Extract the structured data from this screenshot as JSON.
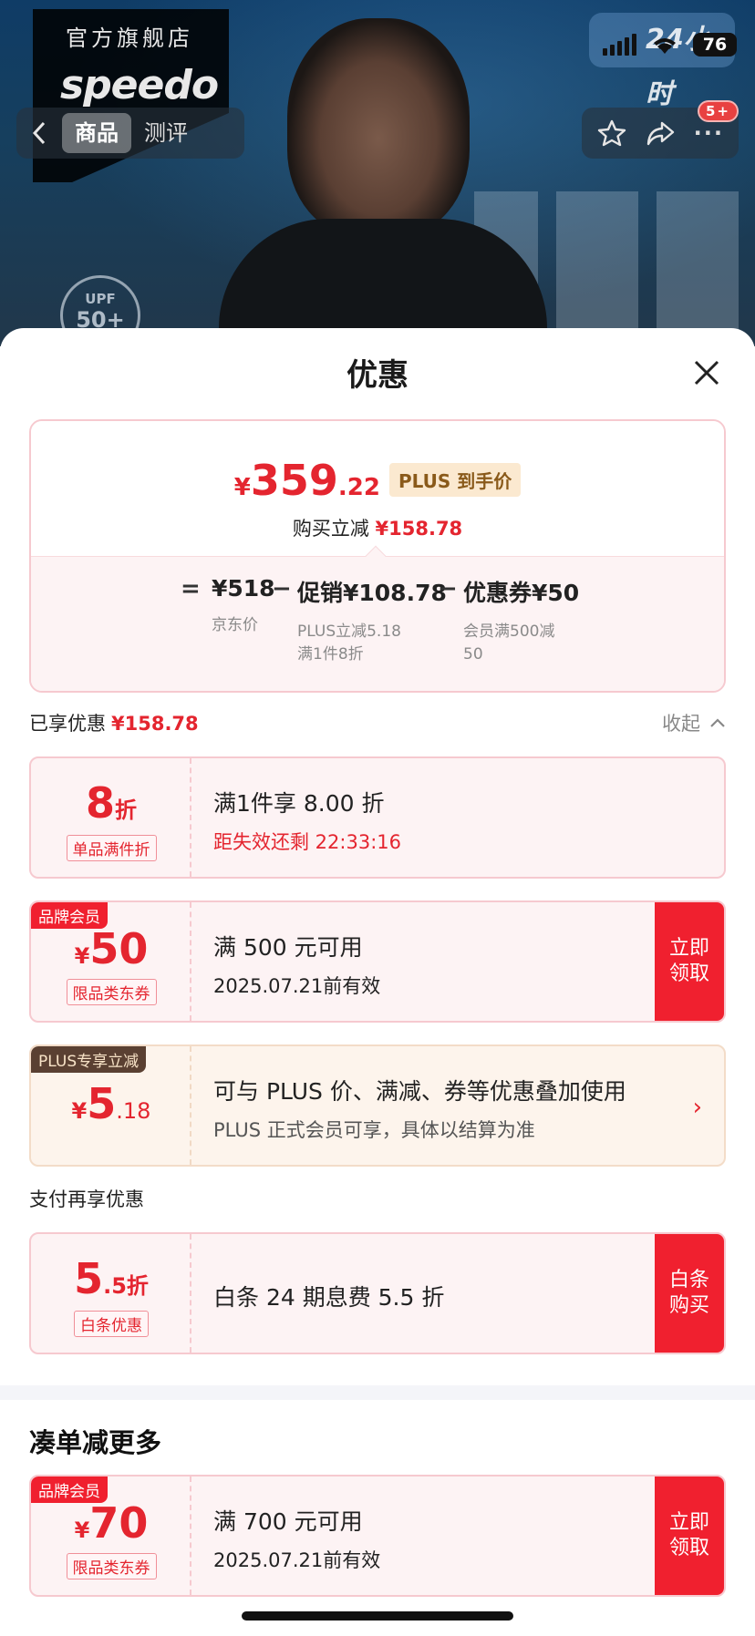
{
  "hero": {
    "store_label": "官方旗舰店",
    "brand": "speedo",
    "upf_label": "UPF",
    "upf_value": "50+",
    "badge": "24小时"
  },
  "status_bar": {
    "battery": "76"
  },
  "nav": {
    "tabs": [
      {
        "label": "商品",
        "active": true
      },
      {
        "label": "测评",
        "active": false
      }
    ],
    "more_badge": "5+"
  },
  "sheet": {
    "title": "优惠",
    "summary": {
      "currency": "¥",
      "price_int": "359",
      "price_dec": ".22",
      "price_tag": "PLUS 到手价",
      "reduce_label": "购买立减",
      "reduce_value": "¥158.78",
      "equals": "=",
      "minus": "−",
      "items": [
        {
          "main": "¥518",
          "sub": [
            "京东价"
          ]
        },
        {
          "main": "促销¥108.78",
          "sub": [
            "PLUS立减5.18",
            "满1件8折"
          ]
        },
        {
          "main": "优惠券¥50",
          "sub": [
            "会员满500减",
            "50"
          ]
        }
      ]
    },
    "enjoyed_label": "已享优惠",
    "enjoyed_value": "¥158.78",
    "collapse_label": "收起",
    "cards": [
      {
        "big_main": "8",
        "big_suffix": "折",
        "chip": "单品满件折",
        "line1": "满1件享 8.00 折",
        "line2": "距失效还剩 22:33:16"
      },
      {
        "corner": "品牌会员",
        "currency": "¥",
        "big_main": "50",
        "chip": "限品类东券",
        "line1": "满 500 元可用",
        "line2": "2025.07.21前有效",
        "action": "立即领取"
      },
      {
        "corner": "PLUS专享立减",
        "currency": "¥",
        "big_main": "5",
        "big_suffix": ".18",
        "line1": "可与 PLUS 价、满减、券等优惠叠加使用",
        "line2": "PLUS 正式会员可享，具体以结算为准"
      }
    ],
    "pay_title": "支付再享优惠",
    "pay_card": {
      "big_main": "5",
      "big_suffix": ".5折",
      "chip": "白条优惠",
      "line1": "白条 24 期息费 5.5 折",
      "action": "白条购买"
    },
    "more_title": "凑单减更多",
    "more_card": {
      "corner": "品牌会员",
      "currency": "¥",
      "big_main": "70",
      "chip": "限品类东券",
      "line1": "满 700 元可用",
      "line2": "2025.07.21前有效",
      "action": "立即领取"
    }
  }
}
